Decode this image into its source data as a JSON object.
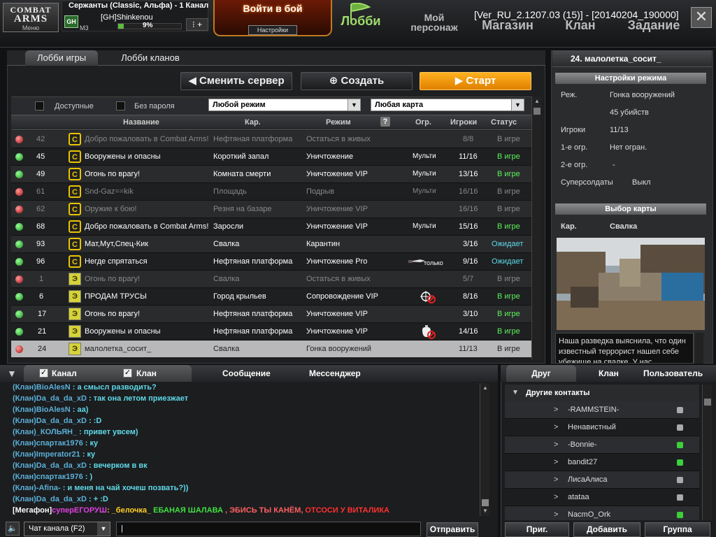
{
  "top": {
    "logo": {
      "line1": "COMBAT",
      "line2": "ARMS",
      "menu": "Меню"
    },
    "channel": "Сержанты (Classic, Альфа) - 1 Канал",
    "clan_tag": "GH",
    "player_name": "[GH]Shinkenou",
    "rank": "M3",
    "xp_percent": "9%",
    "xp_fraction": 0.09,
    "battle_button": "Войти в бой",
    "settings_button": "Настройки",
    "nav": {
      "lobby": "Лобби",
      "my_char_1": "Мой",
      "my_char_2": "персонаж",
      "shop": "Магазин",
      "clan": "Клан",
      "task": "Задание"
    },
    "version": "[Ver_RU_2.1207.03 (15)] - [20140204_190000]",
    "close": "✕"
  },
  "lobby": {
    "tabs": [
      "Лобби игры",
      "Лобби кланов"
    ],
    "buttons": {
      "change_server": "Сменить сервер",
      "create": "Создать",
      "start": "Старт"
    },
    "filters": {
      "available": "Доступные",
      "no_password": "Без пароля",
      "mode": "Любой режим",
      "map": "Любая карта"
    },
    "headers": {
      "name": "Название",
      "map": "Кар.",
      "mode": "Режим",
      "limit": "Огр.",
      "players": "Игроки",
      "status": "Статус"
    },
    "rows": [
      {
        "num": "42",
        "name": "Добро пожаловать в Combat Arms!",
        "map": "Нефтяная платформа",
        "mode": "Остаться в живых",
        "limit": "",
        "players": "8/8",
        "status": "В игре"
      },
      {
        "num": "45",
        "name": "Вооружены и опасны",
        "map": "Короткий запал",
        "mode": "Уничтожение",
        "limit": "Мульти",
        "players": "11/16",
        "status": "В игре"
      },
      {
        "num": "49",
        "name": "Огонь по врагу!",
        "map": "Комната смерти",
        "mode": "Уничтожение VIP",
        "limit": "Мульти",
        "players": "13/16",
        "status": "В игре"
      },
      {
        "num": "61",
        "name": "Snd-Gaz==kik",
        "map": "Площадь",
        "mode": "Подрыв",
        "limit": "Мульти",
        "players": "16/16",
        "status": "В игре"
      },
      {
        "num": "62",
        "name": "Оружие к бою!",
        "map": "Резня на базаре",
        "mode": "Уничтожение VIP",
        "limit": "",
        "players": "16/16",
        "status": "В игре"
      },
      {
        "num": "68",
        "name": "Добро пожаловать в Combat Arms!",
        "map": "Заросли",
        "mode": "Уничтожение VIP",
        "limit": "Мульти",
        "players": "15/16",
        "status": "В игре"
      },
      {
        "num": "93",
        "name": "Мат,Мут,Спец-Кик",
        "map": "Свалка",
        "mode": "Карантин",
        "limit": "",
        "players": "3/16",
        "status": "Ожидает"
      },
      {
        "num": "96",
        "name": "Негде спрятаться",
        "map": "Нефтяная платформа",
        "mode": "Уничтожение Pro",
        "limit": "только",
        "players": "9/16",
        "status": "Ожидает"
      },
      {
        "num": "1",
        "name": "Огонь по врагу!",
        "map": "Свалка",
        "mode": "Остаться в живых",
        "limit": "",
        "players": "5/7",
        "status": "В игре"
      },
      {
        "num": "6",
        "name": "ПРОДАМ ТРУСЫ",
        "map": "Город крыльев",
        "mode": "Сопровождение VIP",
        "limit": "",
        "players": "8/16",
        "status": "В игре"
      },
      {
        "num": "17",
        "name": "Огонь по врагу!",
        "map": "Нефтяная платформа",
        "mode": "Уничтожение VIP",
        "limit": "",
        "players": "3/10",
        "status": "В игре"
      },
      {
        "num": "21",
        "name": "Вооружены и опасны",
        "map": "Нефтяная платформа",
        "mode": "Уничтожение VIP",
        "limit": "",
        "players": "14/16",
        "status": "В игре"
      },
      {
        "num": "24",
        "name": "малолетка_сосит_",
        "map": "Свалка",
        "mode": "Гонка вооружений",
        "limit": "",
        "players": "11/13",
        "status": "В игре"
      }
    ]
  },
  "room": {
    "title": "24. малолетка_сосит_",
    "mode_settings": "Настройки режима",
    "labels": {
      "mode": "Реж.",
      "players": "Игроки",
      "first": "1-е огр.",
      "second": "2-е огр.",
      "super": "Суперсолдаты",
      "map": "Кар."
    },
    "values": {
      "mode": "Гонка вооружений",
      "kills": "45 убийств",
      "players": "11/13",
      "first": "Нет огран.",
      "second": "-",
      "super": "Выкл",
      "map": "Свалка"
    },
    "map_select": "Выбор карты",
    "desc": "Наша разведка выяснила, что один известный террорист нашел себе убежище на свалке. У нас"
  },
  "chat": {
    "tabs": {
      "channel": "Канал",
      "clan": "Клан",
      "message": "Сообщение",
      "messenger": "Мессенджер"
    },
    "lines": [
      {
        "name": "(Клан)BioAlesN",
        "msg": ": а смысл разводить?"
      },
      {
        "name": "(Клан)Da_da_da_xD",
        "msg": ": так она летом приезжает"
      },
      {
        "name": "(Клан)BioAlesN",
        "msg": ": аа)"
      },
      {
        "name": "(Клан)Da_da_da_xD",
        "msg": ": :D"
      },
      {
        "name": "(Клан)_КОЛЬЯН_",
        "msg": ": привет увсем)"
      },
      {
        "name": "(Клан)спартак1976",
        "msg": ": ку"
      },
      {
        "name": "(Клан)Imperator21",
        "msg": ": ку"
      },
      {
        "name": "(Клан)Da_da_da_xD",
        "msg": ": вечерком в вк"
      },
      {
        "name": "(Клан)спартак1976",
        "msg": ": )"
      },
      {
        "name": "(Клан)-Afina-",
        "msg": ": и меня на чай хочеш позвать?))"
      },
      {
        "name": "(Клан)Da_da_da_xD",
        "msg": ": + :D"
      }
    ],
    "mega": {
      "tag": "[Мегафон]",
      "user": "суперЕГОРУШ",
      "p1": ": _белочка_",
      "p2": " ЕБАНАЯ ШАЛАВА",
      "p3": " , ЭБИСЬ ТЫ КАНЁМ,",
      "p4": " ОТСОСИ У ВИТАЛИКА"
    },
    "channel_select": "Чат канала (F2)",
    "send": "Отправить"
  },
  "friends": {
    "tabs": {
      "friend": "Друг",
      "clan": "Клан",
      "user": "Пользователь"
    },
    "group": "Другие контакты",
    "list": [
      "-RAMMSTEIN-",
      "Ненавистный",
      "-Bonnie-",
      "bandit27",
      "ЛисаАлиса",
      "atataa",
      "NacmO_Ork"
    ],
    "buttons": {
      "invite": "Приг.",
      "add": "Добавить",
      "group": "Группа"
    }
  }
}
